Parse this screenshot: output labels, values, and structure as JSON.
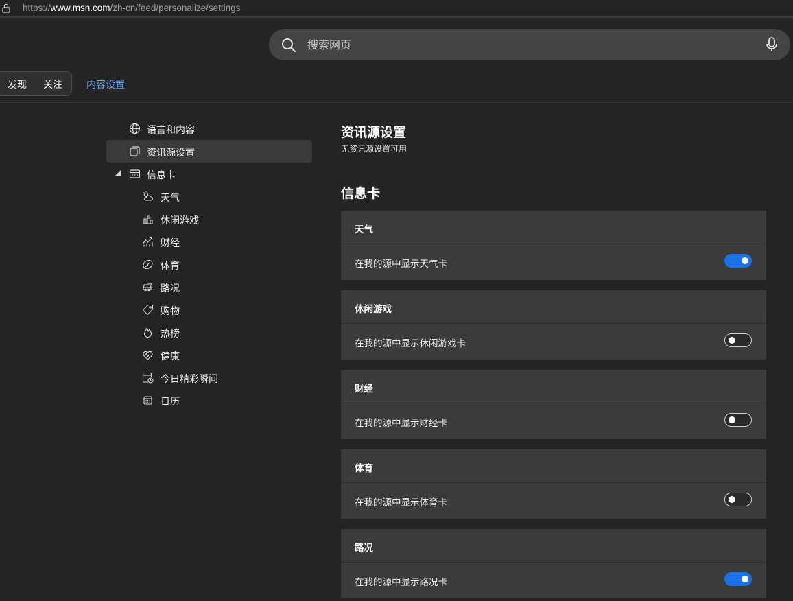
{
  "browser": {
    "url_prefix": "https://",
    "url_domain": "www.msn.com",
    "url_path": "/zh-cn/feed/personalize/settings"
  },
  "search": {
    "placeholder": "搜索网页"
  },
  "tabs": [
    {
      "label": "发现"
    },
    {
      "label": "关注"
    },
    {
      "label": "内容设置",
      "active": true
    }
  ],
  "sidebar": {
    "items": [
      {
        "label": "语言和内容",
        "icon": "globe-icon"
      },
      {
        "label": "资讯源设置",
        "icon": "pages-icon",
        "selected": true
      },
      {
        "label": "信息卡",
        "icon": "card-icon",
        "expanded": true
      },
      {
        "label": "天气",
        "icon": "weather-icon"
      },
      {
        "label": "休闲游戏",
        "icon": "games-icon"
      },
      {
        "label": "财经",
        "icon": "finance-icon"
      },
      {
        "label": "体育",
        "icon": "sports-icon"
      },
      {
        "label": "路况",
        "icon": "traffic-icon"
      },
      {
        "label": "购物",
        "icon": "shopping-tag-icon"
      },
      {
        "label": "热榜",
        "icon": "trending-flame-icon"
      },
      {
        "label": "健康",
        "icon": "health-heart-icon"
      },
      {
        "label": "今日精彩瞬间",
        "icon": "moments-icon"
      },
      {
        "label": "日历",
        "icon": "calendar-icon"
      }
    ]
  },
  "main": {
    "feed_settings": {
      "title": "资讯源设置",
      "subtitle": "无资讯源设置可用"
    },
    "cards_section": {
      "title": "信息卡",
      "cards": [
        {
          "title": "天气",
          "row": "在我的源中显示天气卡",
          "enabled": true
        },
        {
          "title": "休闲游戏",
          "row": "在我的源中显示休闲游戏卡",
          "enabled": false
        },
        {
          "title": "财经",
          "row": "在我的源中显示财经卡",
          "enabled": false
        },
        {
          "title": "体育",
          "row": "在我的源中显示体育卡",
          "enabled": false
        },
        {
          "title": "路况",
          "row": "在我的源中显示路况卡",
          "enabled": true
        }
      ]
    }
  },
  "colors": {
    "background": "#242424",
    "card": "#3b3b3b",
    "accent": "#1a73e8",
    "active_tab": "#6aa8f7"
  }
}
